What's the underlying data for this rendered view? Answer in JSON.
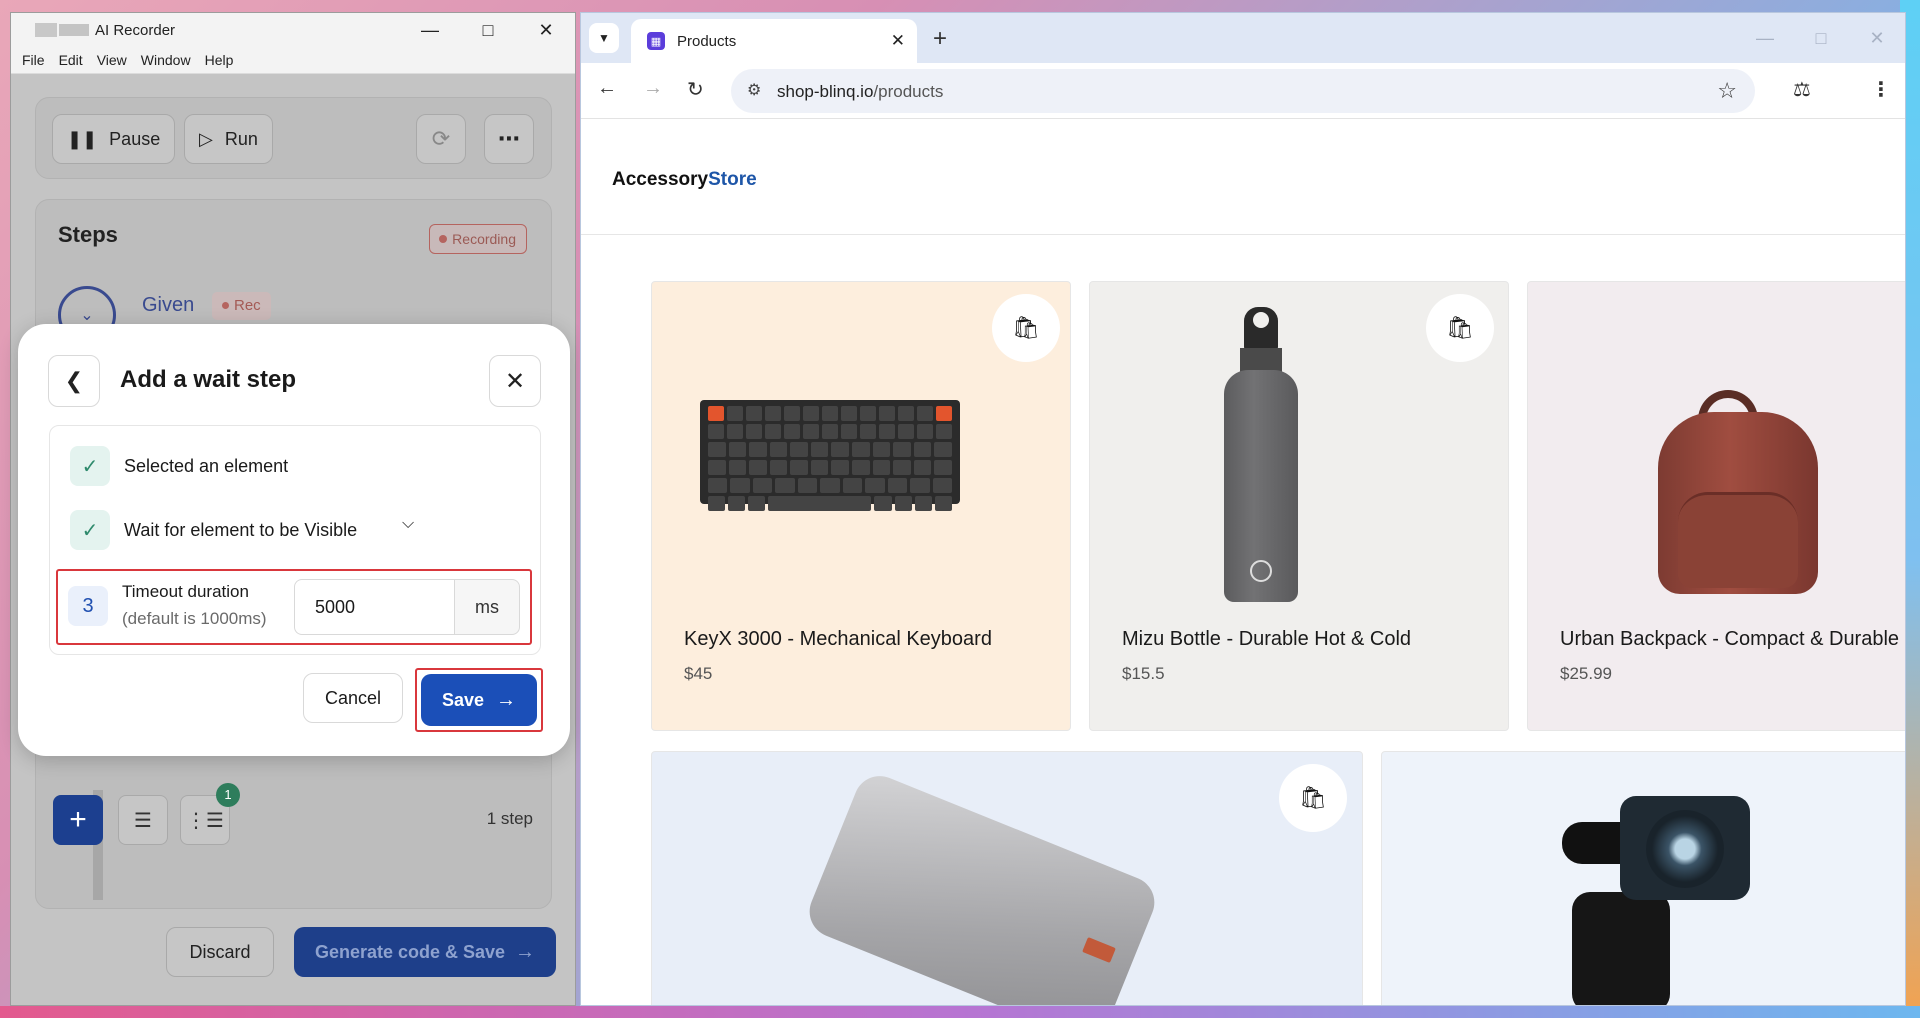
{
  "recorder": {
    "title": "AI Recorder",
    "menu": [
      "File",
      "Edit",
      "View",
      "Window",
      "Help"
    ],
    "toolbar": {
      "pause_label": "Pause",
      "run_label": "Run"
    },
    "steps": {
      "title": "Steps",
      "recording_badge": "Recording",
      "given_label": "Given",
      "rec_badge": "Rec",
      "count_badge": "1",
      "step_count": "1 step"
    },
    "footer": {
      "discard_label": "Discard",
      "generate_label": "Generate code & Save"
    }
  },
  "dialog": {
    "title": "Add a wait step",
    "items": [
      {
        "label": "Selected an element"
      },
      {
        "label": "Wait for element to be Visible"
      }
    ],
    "timeout": {
      "index": "3",
      "label": "Timeout duration",
      "sublabel": "(default is 1000ms)",
      "value": "5000",
      "unit": "ms"
    },
    "cancel_label": "Cancel",
    "save_label": "Save"
  },
  "browser": {
    "tab_title": "Products",
    "url_host": "shop-blinq.io",
    "url_path": "/products"
  },
  "store": {
    "logo_main": "Accessory",
    "logo_accent": "Store",
    "products": [
      {
        "name": "KeyX 3000 - Mechanical Keyboard",
        "price": "$45"
      },
      {
        "name": "Mizu Bottle - Durable Hot & Cold",
        "price": "$15.5"
      },
      {
        "name": "Urban Backpack - Compact & Durable",
        "price": "$25.99"
      }
    ]
  },
  "colors": {
    "accent_blue": "#1b4fb8",
    "highlight_red": "#d9373c",
    "check_green": "#2e8a6c",
    "card_keyboard_bg": "#fdeedd",
    "card_bottle_bg": "#f0efed",
    "card_backpack_bg": "#f2ecef",
    "card_powerbank_bg": "#e8eef8",
    "card_camera_bg": "#eef3fa"
  },
  "icons": {
    "pause": "pause-icon",
    "run": "play-icon",
    "refresh": "refresh-icon",
    "more": "more-horizontal-icon",
    "add": "plus-icon",
    "checklist": "checklist-icon",
    "steps_list": "steps-list-icon",
    "check": "check-icon",
    "back": "chevron-left-icon",
    "close": "close-icon",
    "chevron": "chevron-down-icon",
    "arrow": "arrow-right-icon",
    "bag": "shopping-bag-icon"
  }
}
